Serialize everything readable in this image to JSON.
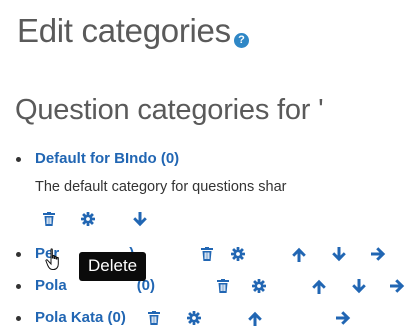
{
  "page": {
    "title": "Edit categories",
    "help_glyph": "?"
  },
  "section": {
    "title": "Question categories for '"
  },
  "categories": [
    {
      "label": "Default for BIndo (0)",
      "description": "The default category for questions shar"
    },
    {
      "label": "Perilaku (0)",
      "partial_visible": "Per",
      "partial_visible_tail": ")"
    },
    {
      "label": "Pola Kalimat (0)",
      "partial_visible": "Pola",
      "partial_visible_tail": "(0)"
    },
    {
      "label": "Pola Kata (0)"
    }
  ],
  "tooltip": {
    "text": "Delete"
  },
  "icons": {
    "delete": "trash-icon",
    "settings": "gear-icon",
    "move_up": "arrow-up-icon",
    "move_down": "arrow-down-icon",
    "move_right": "arrow-right-icon",
    "help": "help-icon",
    "pointer": "hand-cursor-icon"
  },
  "colors": {
    "link": "#2166b3",
    "heading": "#5a5a5a",
    "tooltip_bg": "#0b0b0b",
    "help_icon": "#2f87c6"
  }
}
